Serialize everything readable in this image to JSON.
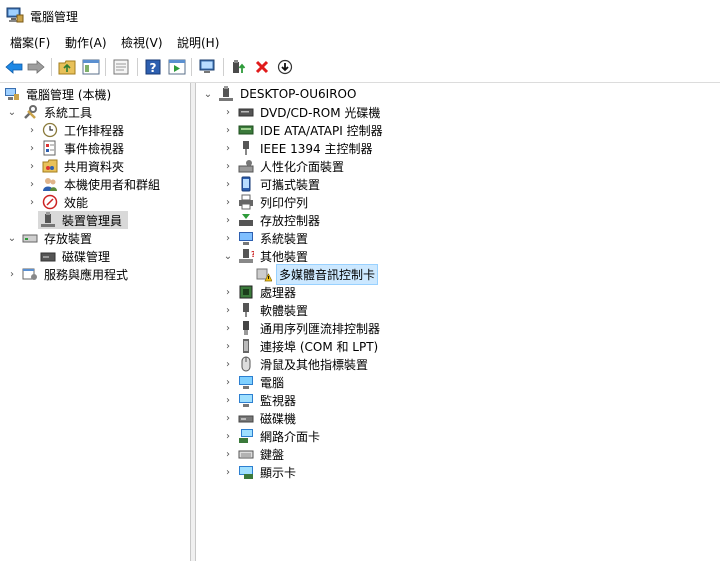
{
  "window": {
    "title": "電腦管理"
  },
  "menu": [
    "檔案(F)",
    "動作(A)",
    "檢視(V)",
    "說明(H)"
  ],
  "toolbar": [
    "back-icon",
    "forward-icon",
    "up-folder-icon",
    "show-tree-icon",
    "properties-icon",
    "help-icon",
    "action-pane-icon",
    "scan-hardware-icon",
    "update-driver-icon",
    "uninstall-icon",
    "disable-icon"
  ],
  "left_tree": {
    "root": "電腦管理 (本機)",
    "system_tools": "系統工具",
    "task_scheduler": "工作排程器",
    "event_viewer": "事件檢視器",
    "shared_folders": "共用資料夾",
    "local_users": "本機使用者和群組",
    "performance": "效能",
    "device_manager": "裝置管理員",
    "storage": "存放裝置",
    "disk_management": "磁碟管理",
    "services": "服務與應用程式"
  },
  "right_tree": {
    "root": "DESKTOP-OU6IROO",
    "items": [
      "DVD/CD-ROM 光碟機",
      "IDE ATA/ATAPI 控制器",
      "IEEE 1394 主控制器",
      "人性化介面裝置",
      "可攜式裝置",
      "列印佇列",
      "存放控制器",
      "系統裝置",
      "其他裝置",
      "多媒體音訊控制卡",
      "處理器",
      "軟體裝置",
      "通用序列匯流排控制器",
      "連接埠 (COM 和 LPT)",
      "滑鼠及其他指標裝置",
      "電腦",
      "監視器",
      "磁碟機",
      "網路介面卡",
      "鍵盤",
      "顯示卡"
    ]
  }
}
